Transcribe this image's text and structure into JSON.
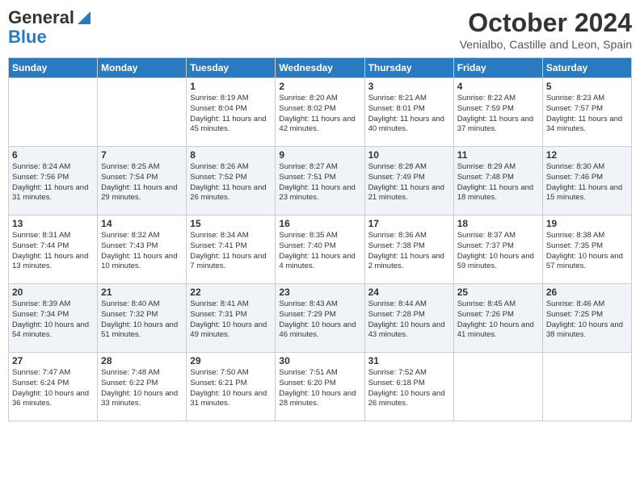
{
  "header": {
    "logo_line1": "General",
    "logo_line2": "Blue",
    "month": "October 2024",
    "location": "Venialbo, Castille and Leon, Spain"
  },
  "days_of_week": [
    "Sunday",
    "Monday",
    "Tuesday",
    "Wednesday",
    "Thursday",
    "Friday",
    "Saturday"
  ],
  "weeks": [
    [
      {
        "day": "",
        "info": ""
      },
      {
        "day": "",
        "info": ""
      },
      {
        "day": "1",
        "info": "Sunrise: 8:19 AM\nSunset: 8:04 PM\nDaylight: 11 hours and 45 minutes."
      },
      {
        "day": "2",
        "info": "Sunrise: 8:20 AM\nSunset: 8:02 PM\nDaylight: 11 hours and 42 minutes."
      },
      {
        "day": "3",
        "info": "Sunrise: 8:21 AM\nSunset: 8:01 PM\nDaylight: 11 hours and 40 minutes."
      },
      {
        "day": "4",
        "info": "Sunrise: 8:22 AM\nSunset: 7:59 PM\nDaylight: 11 hours and 37 minutes."
      },
      {
        "day": "5",
        "info": "Sunrise: 8:23 AM\nSunset: 7:57 PM\nDaylight: 11 hours and 34 minutes."
      }
    ],
    [
      {
        "day": "6",
        "info": "Sunrise: 8:24 AM\nSunset: 7:56 PM\nDaylight: 11 hours and 31 minutes."
      },
      {
        "day": "7",
        "info": "Sunrise: 8:25 AM\nSunset: 7:54 PM\nDaylight: 11 hours and 29 minutes."
      },
      {
        "day": "8",
        "info": "Sunrise: 8:26 AM\nSunset: 7:52 PM\nDaylight: 11 hours and 26 minutes."
      },
      {
        "day": "9",
        "info": "Sunrise: 8:27 AM\nSunset: 7:51 PM\nDaylight: 11 hours and 23 minutes."
      },
      {
        "day": "10",
        "info": "Sunrise: 8:28 AM\nSunset: 7:49 PM\nDaylight: 11 hours and 21 minutes."
      },
      {
        "day": "11",
        "info": "Sunrise: 8:29 AM\nSunset: 7:48 PM\nDaylight: 11 hours and 18 minutes."
      },
      {
        "day": "12",
        "info": "Sunrise: 8:30 AM\nSunset: 7:46 PM\nDaylight: 11 hours and 15 minutes."
      }
    ],
    [
      {
        "day": "13",
        "info": "Sunrise: 8:31 AM\nSunset: 7:44 PM\nDaylight: 11 hours and 13 minutes."
      },
      {
        "day": "14",
        "info": "Sunrise: 8:32 AM\nSunset: 7:43 PM\nDaylight: 11 hours and 10 minutes."
      },
      {
        "day": "15",
        "info": "Sunrise: 8:34 AM\nSunset: 7:41 PM\nDaylight: 11 hours and 7 minutes."
      },
      {
        "day": "16",
        "info": "Sunrise: 8:35 AM\nSunset: 7:40 PM\nDaylight: 11 hours and 4 minutes."
      },
      {
        "day": "17",
        "info": "Sunrise: 8:36 AM\nSunset: 7:38 PM\nDaylight: 11 hours and 2 minutes."
      },
      {
        "day": "18",
        "info": "Sunrise: 8:37 AM\nSunset: 7:37 PM\nDaylight: 10 hours and 59 minutes."
      },
      {
        "day": "19",
        "info": "Sunrise: 8:38 AM\nSunset: 7:35 PM\nDaylight: 10 hours and 57 minutes."
      }
    ],
    [
      {
        "day": "20",
        "info": "Sunrise: 8:39 AM\nSunset: 7:34 PM\nDaylight: 10 hours and 54 minutes."
      },
      {
        "day": "21",
        "info": "Sunrise: 8:40 AM\nSunset: 7:32 PM\nDaylight: 10 hours and 51 minutes."
      },
      {
        "day": "22",
        "info": "Sunrise: 8:41 AM\nSunset: 7:31 PM\nDaylight: 10 hours and 49 minutes."
      },
      {
        "day": "23",
        "info": "Sunrise: 8:43 AM\nSunset: 7:29 PM\nDaylight: 10 hours and 46 minutes."
      },
      {
        "day": "24",
        "info": "Sunrise: 8:44 AM\nSunset: 7:28 PM\nDaylight: 10 hours and 43 minutes."
      },
      {
        "day": "25",
        "info": "Sunrise: 8:45 AM\nSunset: 7:26 PM\nDaylight: 10 hours and 41 minutes."
      },
      {
        "day": "26",
        "info": "Sunrise: 8:46 AM\nSunset: 7:25 PM\nDaylight: 10 hours and 38 minutes."
      }
    ],
    [
      {
        "day": "27",
        "info": "Sunrise: 7:47 AM\nSunset: 6:24 PM\nDaylight: 10 hours and 36 minutes."
      },
      {
        "day": "28",
        "info": "Sunrise: 7:48 AM\nSunset: 6:22 PM\nDaylight: 10 hours and 33 minutes."
      },
      {
        "day": "29",
        "info": "Sunrise: 7:50 AM\nSunset: 6:21 PM\nDaylight: 10 hours and 31 minutes."
      },
      {
        "day": "30",
        "info": "Sunrise: 7:51 AM\nSunset: 6:20 PM\nDaylight: 10 hours and 28 minutes."
      },
      {
        "day": "31",
        "info": "Sunrise: 7:52 AM\nSunset: 6:18 PM\nDaylight: 10 hours and 26 minutes."
      },
      {
        "day": "",
        "info": ""
      },
      {
        "day": "",
        "info": ""
      }
    ]
  ]
}
